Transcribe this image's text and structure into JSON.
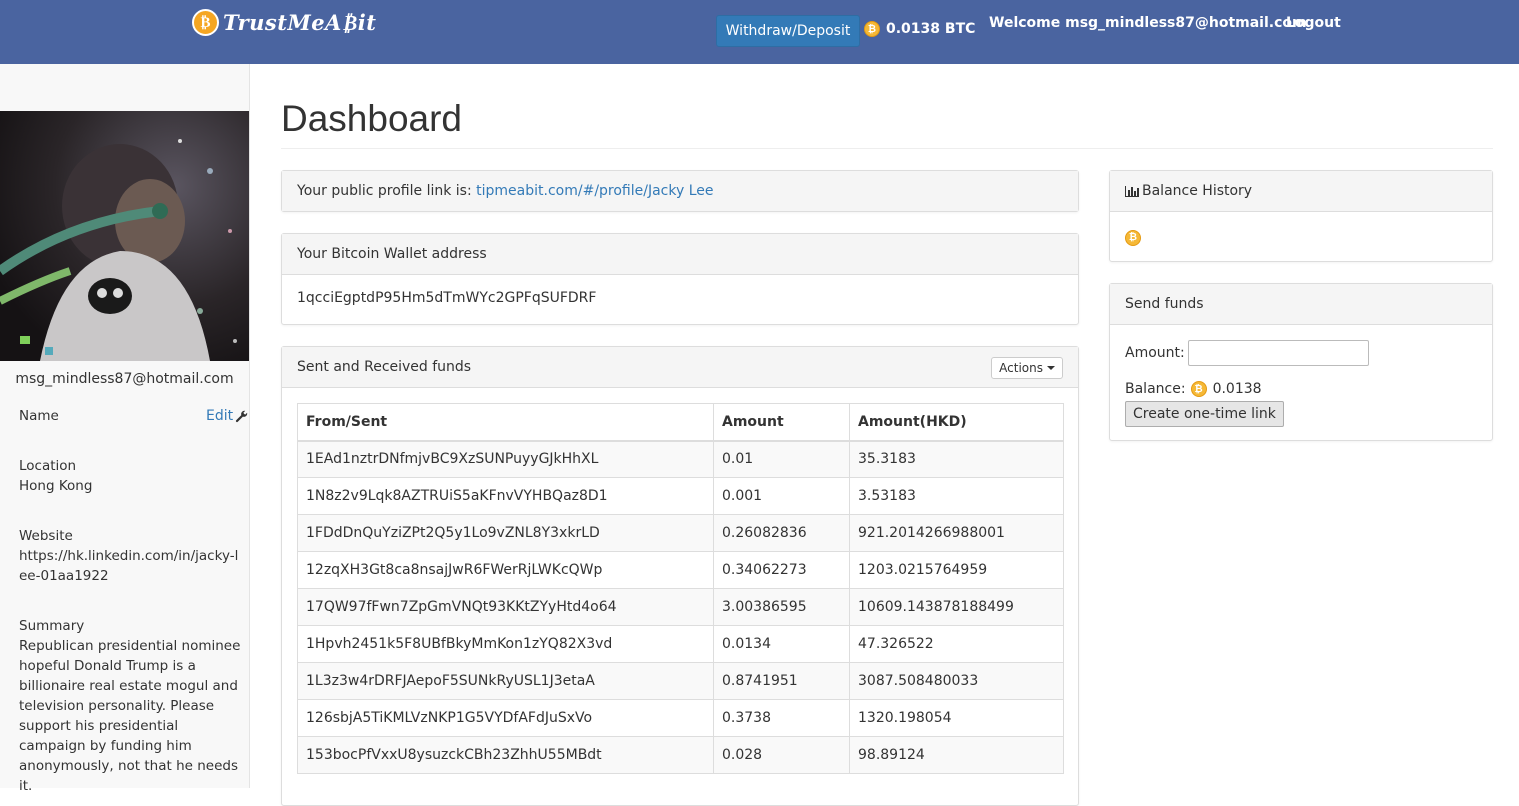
{
  "brand": {
    "name": "TrustMeA₿it",
    "coin_glyph": "₿"
  },
  "navbar": {
    "withdraw_label": "Withdraw/Deposit",
    "balance": "0.0138 BTC",
    "welcome": "Welcome msg_mindless87@hotmail.com",
    "logout_label": "Logout",
    "bg_color": "#4a64a0"
  },
  "sidebar": {
    "email": "msg_mindless87@hotmail.com",
    "name_label": "Name",
    "edit_label": "Edit",
    "location_label": "Location",
    "location_value": "Hong Kong",
    "website_label": "Website",
    "website_value": "https://hk.linkedin.com/in/jacky-lee-01aa1922",
    "summary_label": "Summary",
    "summary_value": "Republican presidential nominee hopeful Donald Trump is a billionaire real estate mogul and television personality. Please support his presidential campaign by funding him anonymously, not that he needs it."
  },
  "main": {
    "title": "Dashboard",
    "profile_link_prefix": "Your public profile link is: ",
    "profile_link": "tipmeabit.com/#/profile/Jacky Lee",
    "wallet_title": "Your Bitcoin Wallet address",
    "wallet_address": "1qcciEgptdP95Hm5dTmWYc2GPFqSUFDRF",
    "funds_title": "Sent and Received funds",
    "actions_label": "Actions",
    "funds_table": {
      "headers": [
        "From/Sent",
        "Amount",
        "Amount(HKD)"
      ],
      "rows": [
        [
          "1EAd1nztrDNfmjvBC9XzSUNPuyyGJkHhXL",
          "0.01",
          "35.3183"
        ],
        [
          "1N8z2v9Lqk8AZTRUiS5aKFnvVYHBQaz8D1",
          "0.001",
          "3.53183"
        ],
        [
          "1FDdDnQuYziZPt2Q5y1Lo9vZNL8Y3xkrLD",
          "0.26082836",
          "921.2014266988001"
        ],
        [
          "12zqXH3Gt8ca8nsajJwR6FWerRjLWKcQWp",
          "0.34062273",
          "1203.0215764959"
        ],
        [
          "17QW97fFwn7ZpGmVNQt93KKtZYyHtd4o64",
          "3.00386595",
          "10609.143878188499"
        ],
        [
          "1Hpvh2451k5F8UBfBkyMmKon1zYQ82X3vd",
          "0.0134",
          "47.326522"
        ],
        [
          "1L3z3w4rDRFJAepoF5SUNkRyUSL1J3etaA",
          "0.8741951",
          "3087.508480033"
        ],
        [
          "126sbjA5TiKMLVzNKP1G5VYDfAFdJuSxVo",
          "0.3738",
          "1320.198054"
        ],
        [
          "153bocPfVxxU8ysuzckCBh23ZhhU55MBdt",
          "0.028",
          "98.89124"
        ]
      ]
    }
  },
  "right": {
    "balance_history_title": "Balance History",
    "send_funds_title": "Send funds",
    "amount_label": "Amount:",
    "amount_value": "",
    "balance_label": "Balance:",
    "balance_value": "0.0138",
    "create_link_label": "Create one-time link"
  },
  "icons": {
    "chart": "bar-chart-icon",
    "edit": "wrench-icon",
    "coin": "bitcoin-coin-icon"
  },
  "colors": {
    "link": "#337ab7",
    "coin": "#f5b836",
    "primary_button": "#337ab7"
  }
}
